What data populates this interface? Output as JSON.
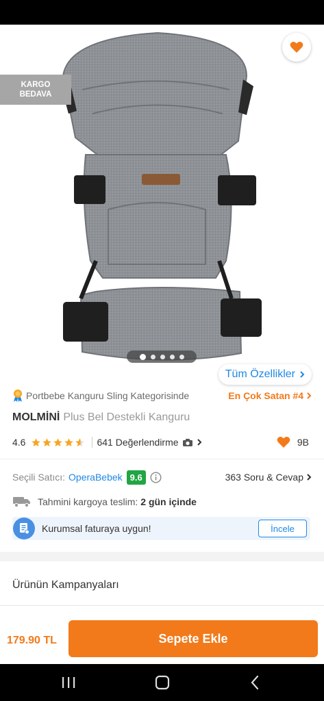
{
  "hero": {
    "kargo_badge_line1": "KARGO",
    "kargo_badge_line2": "BEDAVA",
    "image_count": 5,
    "active_image": 1,
    "all_features_label": "Tüm Özellikler"
  },
  "category": {
    "text": "Portbebe Kanguru Sling Kategorisinde",
    "rank_label": "En Çok Satan #4"
  },
  "product": {
    "brand": "MOLMİNİ",
    "name": "Plus Bel Destekli Kanguru",
    "rating": "4.6",
    "rating_value": 4.6,
    "reviews_label": "641 Değerlendirme",
    "likes": "9B"
  },
  "seller": {
    "label": "Seçili Satıcı:",
    "name": "OperaBebek",
    "score": "9.6",
    "qa_label": "363 Soru & Cevap"
  },
  "shipping": {
    "label": "Tahmini kargoya teslim:",
    "days": "2 gün içinde"
  },
  "invoice": {
    "text": "Kurumsal faturaya uygun!",
    "button": "İncele"
  },
  "campaigns": {
    "title": "Ürünün Kampanyaları"
  },
  "cart": {
    "price": "179.90 TL",
    "button": "Sepete Ekle"
  },
  "colors": {
    "brand_orange": "#f27a1a",
    "link_blue": "#1e88e5",
    "score_green": "#21a545",
    "star_orange": "#f6a623"
  },
  "icons": {
    "back": "arrow-left-icon",
    "share": "share-icon",
    "favorite": "heart-icon",
    "medal": "medal-icon",
    "camera": "camera-icon",
    "info": "info-icon",
    "truck": "truck-icon",
    "invoice": "invoice-icon"
  }
}
